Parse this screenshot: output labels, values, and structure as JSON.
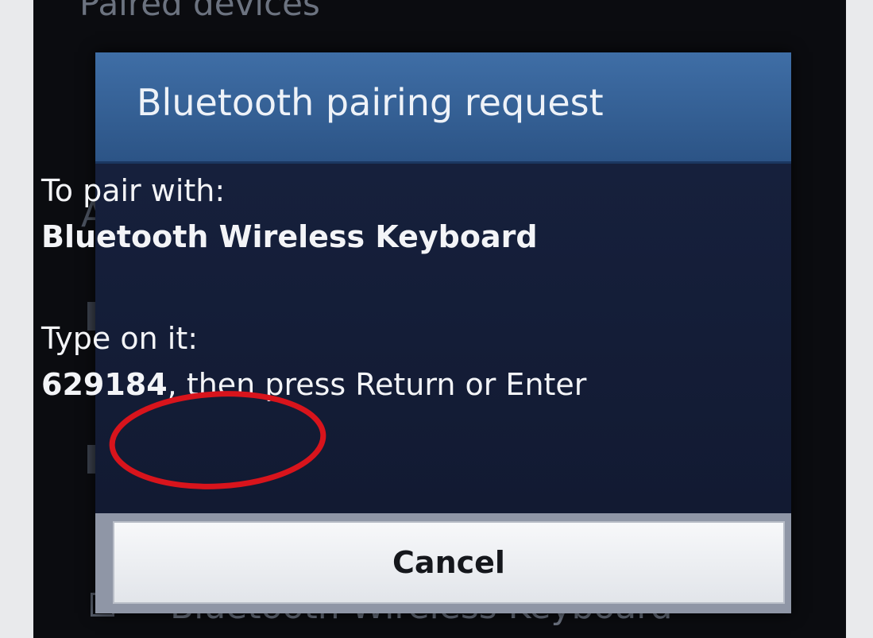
{
  "background": {
    "header_text": "Paired devices",
    "partial_letter": "A",
    "bottom_item_text": "Bluetooth Wireless Keyboard"
  },
  "dialog": {
    "title": "Bluetooth pairing request",
    "pair_prompt": "To pair with:",
    "device_name": "Bluetooth Wireless Keyboard",
    "type_prompt": "Type on it:",
    "passkey": "629184",
    "instruction_suffix": ", then press Return or Enter",
    "cancel_label": "Cancel"
  },
  "colors": {
    "title_bar": "#3a6aa3",
    "dialog_body": "#141c34",
    "annotation_circle": "#d8141c"
  }
}
